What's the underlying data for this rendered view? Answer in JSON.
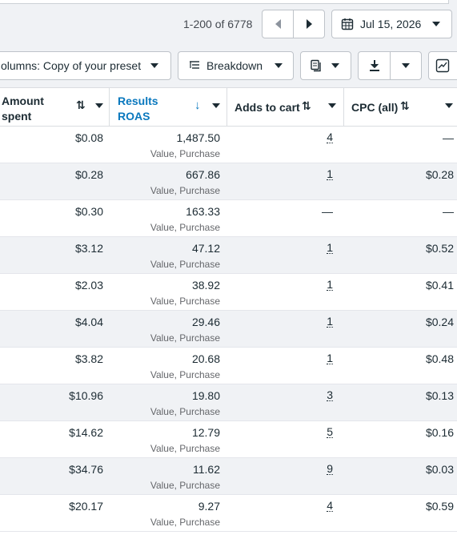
{
  "pagination": {
    "label": "1-200 of 6778"
  },
  "date_picker": {
    "label": "Jul 15, 2026"
  },
  "toolbar": {
    "columns_label": "olumns: Copy of your preset",
    "breakdown_label": "Breakdown"
  },
  "columns": {
    "amount": {
      "line1": "Amount",
      "line2": "spent"
    },
    "results": {
      "line1": "Results",
      "line2": "ROAS"
    },
    "adds": {
      "label": "Adds to cart"
    },
    "cpc": {
      "label": "CPC (all)"
    }
  },
  "rows": [
    {
      "amount": "$0.08",
      "roas": "1,487.50",
      "roas_sub": "Value, Purchase",
      "adds": "4",
      "cpc": "—"
    },
    {
      "amount": "$0.28",
      "roas": "667.86",
      "roas_sub": "Value, Purchase",
      "adds": "1",
      "cpc": "$0.28"
    },
    {
      "amount": "$0.30",
      "roas": "163.33",
      "roas_sub": "Value, Purchase",
      "adds": "—",
      "cpc": "—"
    },
    {
      "amount": "$3.12",
      "roas": "47.12",
      "roas_sub": "Value, Purchase",
      "adds": "1",
      "cpc": "$0.52"
    },
    {
      "amount": "$2.03",
      "roas": "38.92",
      "roas_sub": "Value, Purchase",
      "adds": "1",
      "cpc": "$0.41"
    },
    {
      "amount": "$4.04",
      "roas": "29.46",
      "roas_sub": "Value, Purchase",
      "adds": "1",
      "cpc": "$0.24"
    },
    {
      "amount": "$3.82",
      "roas": "20.68",
      "roas_sub": "Value, Purchase",
      "adds": "1",
      "cpc": "$0.48"
    },
    {
      "amount": "$10.96",
      "roas": "19.80",
      "roas_sub": "Value, Purchase",
      "adds": "3",
      "cpc": "$0.13"
    },
    {
      "amount": "$14.62",
      "roas": "12.79",
      "roas_sub": "Value, Purchase",
      "adds": "5",
      "cpc": "$0.16"
    },
    {
      "amount": "$34.76",
      "roas": "11.62",
      "roas_sub": "Value, Purchase",
      "adds": "9",
      "cpc": "$0.03"
    },
    {
      "amount": "$20.17",
      "roas": "9.27",
      "roas_sub": "Value, Purchase",
      "adds": "4",
      "cpc": "$0.59"
    }
  ],
  "colors": {
    "accent": "#0a78be",
    "header_bg": "#ffffff",
    "row_alt": "#f0f2f5"
  },
  "icons": [
    "prev-page-icon",
    "next-page-icon",
    "calendar-icon",
    "breakdown-icon",
    "copy-icon",
    "download-icon",
    "chart-icon",
    "sort-icon",
    "sort-desc-icon",
    "chevron-down-icon"
  ]
}
